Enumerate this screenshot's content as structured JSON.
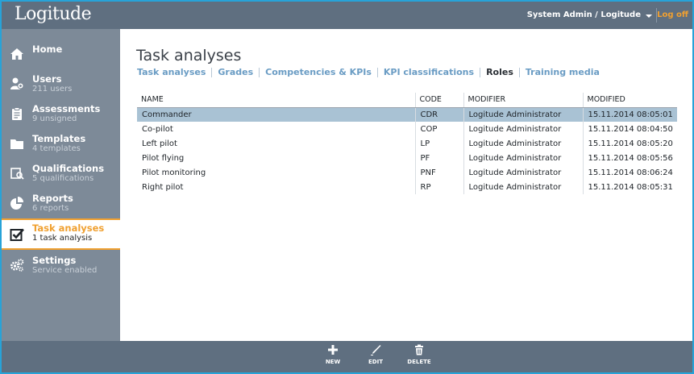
{
  "header": {
    "logo": "Logitude",
    "user": "System Admin / Logitude",
    "logoff": "Log off"
  },
  "sidebar": {
    "items": [
      {
        "title": "Home",
        "subtitle": "",
        "icon": "home-icon"
      },
      {
        "title": "Users",
        "subtitle": "211 users",
        "icon": "users-icon"
      },
      {
        "title": "Assessments",
        "subtitle": "9 unsigned",
        "icon": "clipboard-icon"
      },
      {
        "title": "Templates",
        "subtitle": "4 templates",
        "icon": "folder-icon"
      },
      {
        "title": "Qualifications",
        "subtitle": "5 qualifications",
        "icon": "qualification-icon"
      },
      {
        "title": "Reports",
        "subtitle": "6 reports",
        "icon": "pie-chart-icon"
      },
      {
        "title": "Task analyses",
        "subtitle": "1 task analysis",
        "icon": "checkbox-icon"
      },
      {
        "title": "Settings",
        "subtitle": "Service enabled",
        "icon": "gears-icon"
      }
    ],
    "active_index": 6
  },
  "main": {
    "title": "Task analyses",
    "tabs": [
      {
        "label": "Task analyses"
      },
      {
        "label": "Grades"
      },
      {
        "label": "Competencies & KPIs"
      },
      {
        "label": "KPI classifications"
      },
      {
        "label": "Roles"
      },
      {
        "label": "Training media"
      }
    ],
    "active_tab": 4,
    "table": {
      "columns": [
        "NAME",
        "CODE",
        "MODIFIER",
        "MODIFIED"
      ],
      "rows": [
        [
          "Commander",
          "CDR",
          "Logitude Administrator",
          "15.11.2014 08:05:01"
        ],
        [
          "Co-pilot",
          "COP",
          "Logitude Administrator",
          "15.11.2014 08:04:50"
        ],
        [
          "Left pilot",
          "LP",
          "Logitude Administrator",
          "15.11.2014 08:05:20"
        ],
        [
          "Pilot flying",
          "PF",
          "Logitude Administrator",
          "15.11.2014 08:05:56"
        ],
        [
          "Pilot monitoring",
          "PNF",
          "Logitude Administrator",
          "15.11.2014 08:06:24"
        ],
        [
          "Right pilot",
          "RP",
          "Logitude Administrator",
          "15.11.2014 08:05:31"
        ]
      ],
      "selected_row": 0
    }
  },
  "toolbar": {
    "new_label": "NEW",
    "edit_label": "EDIT",
    "delete_label": "DELETE"
  },
  "colors": {
    "accent": "#f0a030",
    "header_bg": "#5f6f80",
    "sidebar_bg": "#7d8a98",
    "link": "#6a9cc4",
    "selected_row": "#a9c2d4",
    "frame": "#27a3d8"
  }
}
